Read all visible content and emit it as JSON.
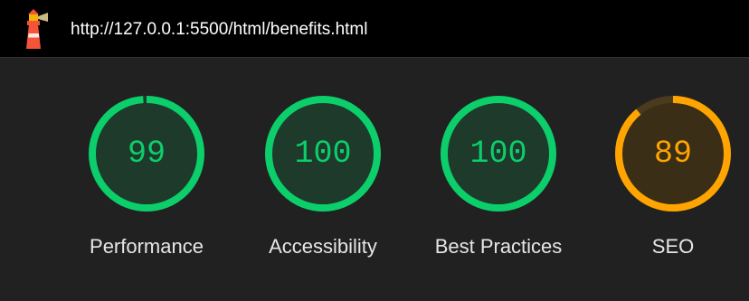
{
  "header": {
    "url": "http://127.0.0.1:5500/html/benefits.html",
    "logo_icon": "lighthouse-icon"
  },
  "colors": {
    "pass": "#0cce6b",
    "pass_fill": "#1e3a2b",
    "average": "#ffa400",
    "average_fill": "#3b2e17",
    "average_track": "#4a3a1e"
  },
  "scores": [
    {
      "value": "99",
      "label": "Performance",
      "score": 0.99,
      "rating": "pass"
    },
    {
      "value": "100",
      "label": "Accessibility",
      "score": 1.0,
      "rating": "pass"
    },
    {
      "value": "100",
      "label": "Best Practices",
      "score": 1.0,
      "rating": "pass"
    },
    {
      "value": "89",
      "label": "SEO",
      "score": 0.89,
      "rating": "average"
    }
  ]
}
